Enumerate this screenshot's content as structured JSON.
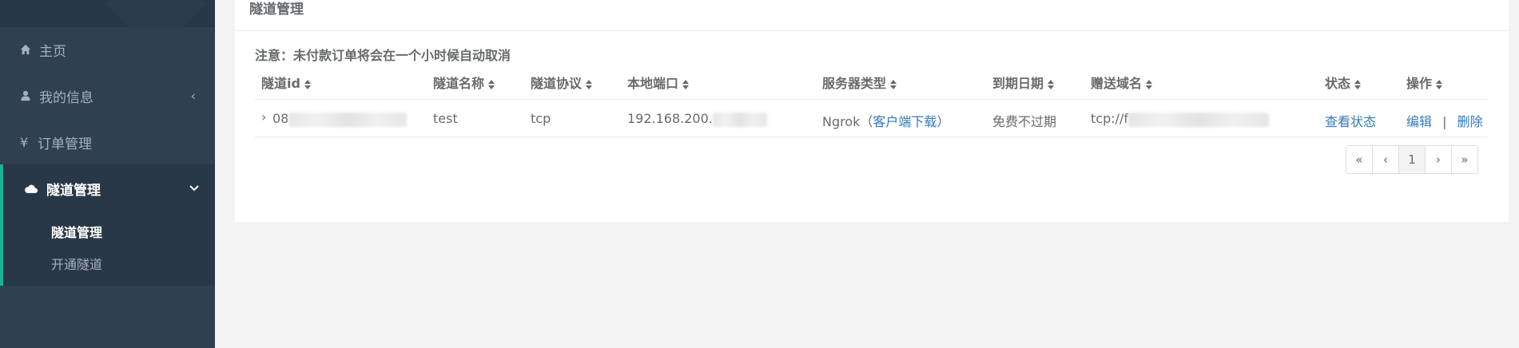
{
  "sidebar": {
    "items": [
      {
        "label": "主页",
        "icon": "home-icon"
      },
      {
        "label": "我的信息",
        "icon": "user-icon",
        "caret": "‹"
      },
      {
        "label": "订单管理",
        "icon": "yen-icon",
        "symbol": "¥"
      }
    ],
    "active": {
      "label": "隧道管理",
      "icon": "cloud-icon",
      "caret": "⌄",
      "subitems": [
        {
          "label": "隧道管理"
        },
        {
          "label": "开通隧道"
        }
      ]
    }
  },
  "panel": {
    "title": "隧道管理",
    "notice": "注意：未付款订单将会在一个小时候自动取消"
  },
  "table": {
    "columns": [
      "隧道id",
      "隧道名称",
      "隧道协议",
      "本地端口",
      "服务器类型",
      "到期日期",
      "赠送域名",
      "状态",
      "操作"
    ],
    "rows": [
      {
        "expand": "›",
        "id": "08",
        "name": "test",
        "protocol": "tcp",
        "port": "192.168.200.",
        "server_type": "Ngrok",
        "download_open": "（",
        "download_link": "客户端下载",
        "download_close": "）",
        "expiry": "免费不过期",
        "domain": "tcp://f",
        "status": "查看状态",
        "edit": "编辑",
        "sep": "|",
        "delete": "删除"
      }
    ]
  },
  "pagination": [
    "«",
    "‹",
    "1",
    "›",
    "»"
  ],
  "colors": {
    "sidebar": "#2f4050",
    "accent": "#1ab394",
    "link": "#337ab7"
  }
}
